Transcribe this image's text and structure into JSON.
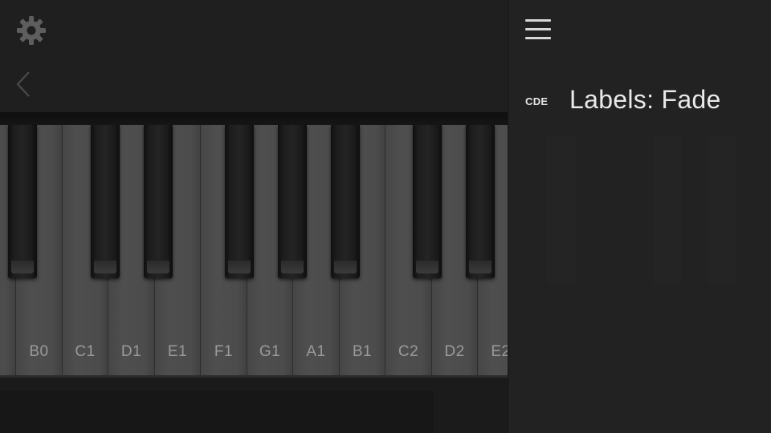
{
  "toolbar": {
    "settings_icon": "gear-icon",
    "back_icon": "chevron-left-icon"
  },
  "keyboard": {
    "white_keys": [
      {
        "label": ""
      },
      {
        "label": "B0"
      },
      {
        "label": "C1"
      },
      {
        "label": "D1"
      },
      {
        "label": "E1"
      },
      {
        "label": "F1"
      },
      {
        "label": "G1"
      },
      {
        "label": "A1"
      },
      {
        "label": "B1"
      },
      {
        "label": "C2"
      },
      {
        "label": "D2"
      },
      {
        "label": "E2"
      }
    ]
  },
  "menu": {
    "icon": "hamburger-menu-icon",
    "items": [
      {
        "icon_text": "CDE",
        "label": "Labels: Fade"
      }
    ]
  },
  "colors": {
    "background": "#1c1c1d",
    "panel": "#222223",
    "white_key": "#4c4c4c",
    "black_key": "#1d1d1e",
    "label_text": "#9a9a9a",
    "menu_text": "#e9e9e9"
  }
}
